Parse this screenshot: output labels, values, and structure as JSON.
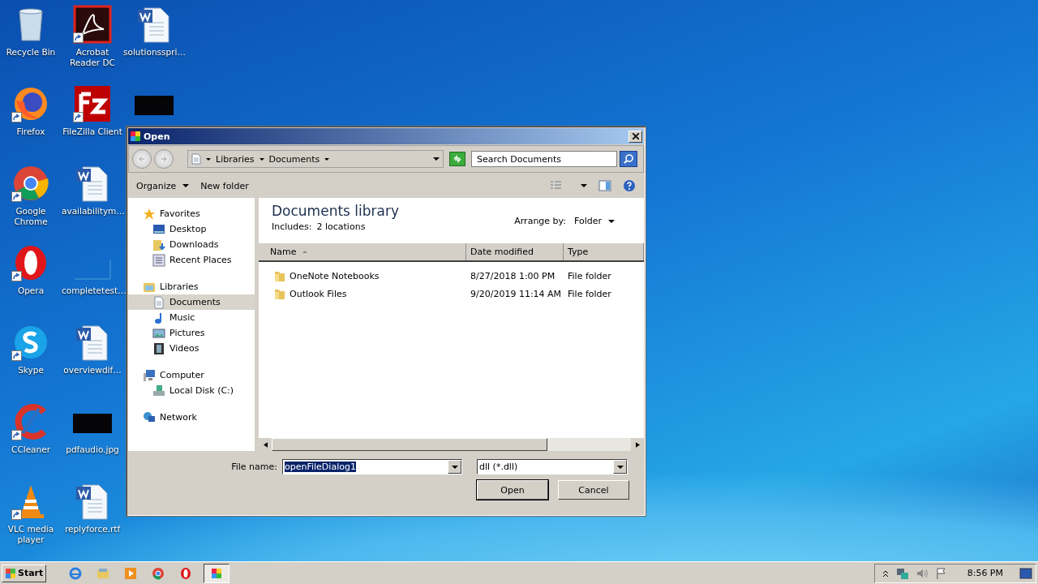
{
  "desktop_icons": [
    {
      "kind": "recycle",
      "label": "Recycle Bin",
      "shortcut": false
    },
    {
      "kind": "firefox",
      "label": "Firefox",
      "shortcut": true
    },
    {
      "kind": "chrome",
      "label": "Google Chrome",
      "shortcut": true
    },
    {
      "kind": "opera",
      "label": "Opera",
      "shortcut": true
    },
    {
      "kind": "skype",
      "label": "Skype",
      "shortcut": true
    },
    {
      "kind": "ccleaner",
      "label": "CCleaner",
      "shortcut": true
    },
    {
      "kind": "vlc",
      "label": "VLC media player",
      "shortcut": true
    },
    {
      "kind": "acrobat",
      "label": "Acrobat Reader DC",
      "shortcut": true
    },
    {
      "kind": "filezilla",
      "label": "FileZilla Client",
      "shortcut": true
    },
    {
      "kind": "word",
      "label": "availabilitym…",
      "shortcut": false
    },
    {
      "kind": "blank",
      "label": "completetest…",
      "shortcut": false
    },
    {
      "kind": "word",
      "label": "overviewdif…",
      "shortcut": false
    },
    {
      "kind": "dark",
      "label": "pdfaudio.jpg",
      "shortcut": false
    },
    {
      "kind": "word",
      "label": "replyforce.rtf",
      "shortcut": false
    },
    {
      "kind": "word",
      "label": "solutionsspri…",
      "shortcut": false
    },
    {
      "kind": "dark",
      "shortcut": false
    }
  ],
  "dialog": {
    "title": "Open",
    "breadcrumb": [
      "Libraries",
      "Documents"
    ],
    "search": {
      "placeholder": "Search Documents"
    },
    "toolbar": {
      "organize": "Organize",
      "new_folder": "New folder"
    },
    "nav": [
      {
        "label": "Favorites",
        "kind": "star",
        "selected": false,
        "children": [
          {
            "label": "Desktop",
            "kind": "desktop",
            "selected": false
          },
          {
            "label": "Downloads",
            "kind": "downloads",
            "selected": false
          },
          {
            "label": "Recent Places",
            "kind": "recent",
            "selected": false
          }
        ]
      },
      {
        "label": "Libraries",
        "kind": "library",
        "selected": false,
        "children": [
          {
            "label": "Documents",
            "kind": "document",
            "selected": true
          },
          {
            "label": "Music",
            "kind": "music",
            "selected": false
          },
          {
            "label": "Pictures",
            "kind": "pictures",
            "selected": false
          },
          {
            "label": "Videos",
            "kind": "videos",
            "selected": false
          }
        ]
      },
      {
        "label": "Computer",
        "kind": "computer",
        "selected": false,
        "children": [
          {
            "label": "Local Disk (C:)",
            "kind": "disk",
            "selected": false
          }
        ]
      },
      {
        "label": "Network",
        "kind": "network",
        "selected": false
      }
    ],
    "library_title": "Documents library",
    "includes_label": "Includes:",
    "includes_value": "2 locations",
    "arrange_label": "Arrange by:",
    "arrange_value": "Folder",
    "columns": [
      "Name",
      "Date modified",
      "Type"
    ],
    "rows": [
      {
        "name": "OneNote Notebooks",
        "date": "8/27/2018 1:00 PM",
        "type": "File folder"
      },
      {
        "name": "Outlook Files",
        "date": "9/20/2019 11:14 AM",
        "type": "File folder"
      }
    ],
    "file_name_label": "File name:",
    "file_name": "openFileDialog1",
    "file_type": "dll (*.dll)",
    "buttons": [
      "Open",
      "Cancel"
    ]
  },
  "taskbar": {
    "start": "Start",
    "apps": [
      {
        "kind": "ie",
        "selected": false
      },
      {
        "kind": "explorer",
        "selected": false
      },
      {
        "kind": "media",
        "selected": false
      },
      {
        "kind": "chrome",
        "selected": false
      },
      {
        "kind": "opera",
        "selected": false
      },
      {
        "kind": "window",
        "selected": true
      }
    ],
    "time": "8:56 PM"
  }
}
